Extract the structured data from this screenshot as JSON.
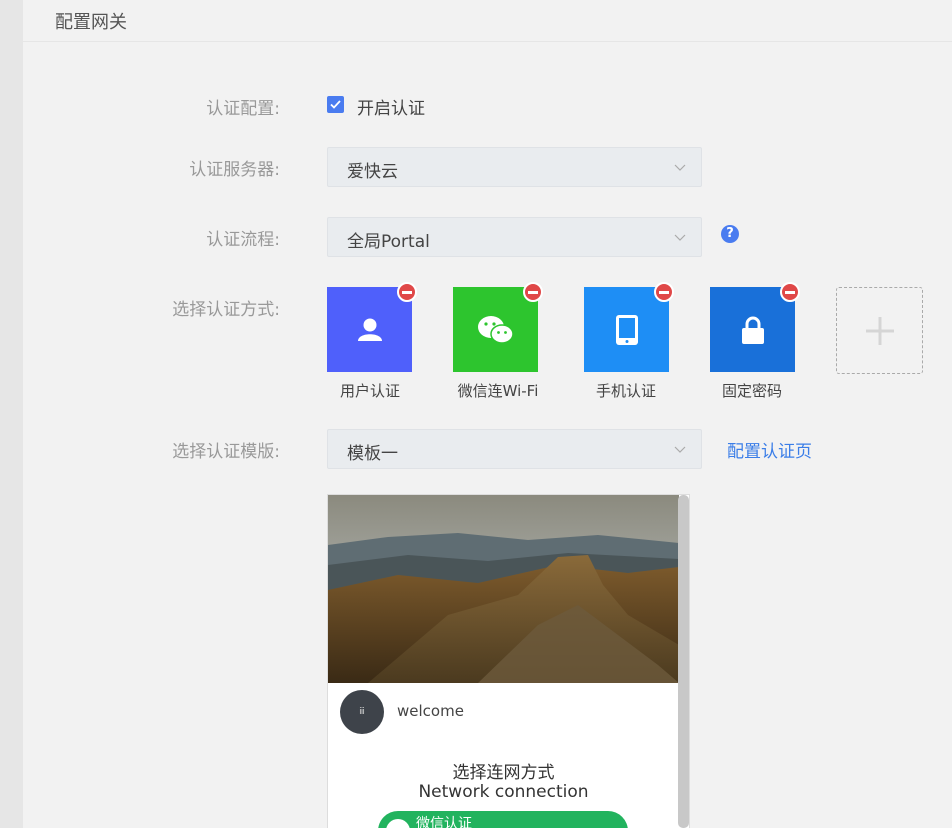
{
  "page": {
    "title": "配置网关"
  },
  "form": {
    "auth_config_label": "认证配置:",
    "enable_auth_label": "开启认证",
    "enable_auth_checked": true,
    "auth_server_label": "认证服务器:",
    "auth_server_value": "爱快云",
    "auth_flow_label": "认证流程:",
    "auth_flow_value": "全局Portal",
    "auth_method_label": "选择认证方式:",
    "auth_template_label": "选择认证模版:",
    "auth_template_value": "模板一",
    "config_page_link": "配置认证页"
  },
  "auth_methods": [
    {
      "label": "用户认证",
      "icon": "user-icon",
      "color": "#4f60fb"
    },
    {
      "label": "微信连Wi-Fi",
      "icon": "wechat-icon",
      "color": "#2dc52e"
    },
    {
      "label": "手机认证",
      "icon": "phone-icon",
      "color": "#1e8ef5"
    },
    {
      "label": "固定密码",
      "icon": "lock-icon",
      "color": "#1970d9"
    }
  ],
  "preview": {
    "avatar_text": "ⅲ",
    "welcome": "welcome",
    "title_cn": "选择连网方式",
    "title_en": "Network connection",
    "wechat_button": "微信认证",
    "button_color": "#22b35e"
  }
}
